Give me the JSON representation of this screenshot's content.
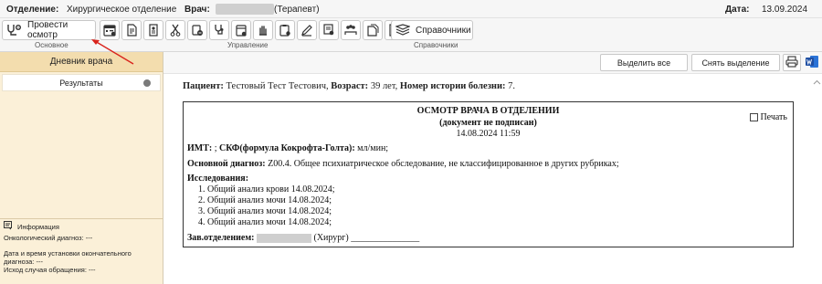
{
  "header": {
    "department_label": "Отделение:",
    "department_value": "Хирургическое отделение",
    "doctor_label": "Врач:",
    "doctor_value": "(Терапевт)",
    "date_label": "Дата:",
    "date_value": "13.09.2024"
  },
  "toolbar": {
    "exam_button": "Провести осмотр",
    "reference_button": "Справочники",
    "group_basic": "Основное",
    "group_manage": "Управление",
    "group_refs": "Справочники",
    "icons": [
      "exam-icon",
      "calendar-list-icon",
      "document-icon",
      "printer-doc-icon",
      "scissors-icon",
      "drugs-icon",
      "stethoscope-icon",
      "calendar-icon",
      "hand-icon",
      "clipboard-icon",
      "pen-edit-icon",
      "certificate-icon",
      "team-icon",
      "folder-icon",
      "chart-icon",
      "stack-icon"
    ]
  },
  "sidebar": {
    "tab_label": "Дневник врача",
    "item_label": "Результаты",
    "info_title": "Информация",
    "onco": "Онкологический диагноз: ---",
    "final_dx": "Дата и время установки окончательного диагноза: ---",
    "outcome": "Исход случая обращения: ---"
  },
  "content": {
    "select_all": "Выделить все",
    "deselect": "Снять выделение"
  },
  "document": {
    "patient_label": "Пациент:",
    "patient_value": "Тестовый Тест Тестович,",
    "age_label": "Возраст:",
    "age_value": "39 лет,",
    "history_label": "Номер истории болезни:",
    "history_value": "7.",
    "title": "ОСМОТР ВРАЧА В ОТДЕЛЕНИИ",
    "subtitle": "(документ не подписан)",
    "datetime": "14.08.2024 11:59",
    "print_label": "Печать",
    "imt_label": "ИМТ:",
    "imt_value": " ;",
    "skf_label": "СКФ(формула Кокрофта-Голта):",
    "skf_value": " мл/мин;",
    "dx_label": "Основной диагноз:",
    "dx_value": " Z00.4. Общее психиатрическое обследование, не классифицированное в других рубриках;",
    "studies_label": "Исследования:",
    "studies": [
      "1. Общий анализ крови 14.08.2024;",
      "2. Общий анализ мочи 14.08.2024;",
      "3. Общий анализ мочи 14.08.2024;",
      "4. Общий анализ мочи 14.08.2024;"
    ],
    "head_label": "Зав.отделением:",
    "head_value": "(Хирург) _______________"
  },
  "colors": {
    "sidebar_bg": "#fbf0d8",
    "sidebar_tab": "#f3ddae",
    "arrow": "#d9231c"
  }
}
